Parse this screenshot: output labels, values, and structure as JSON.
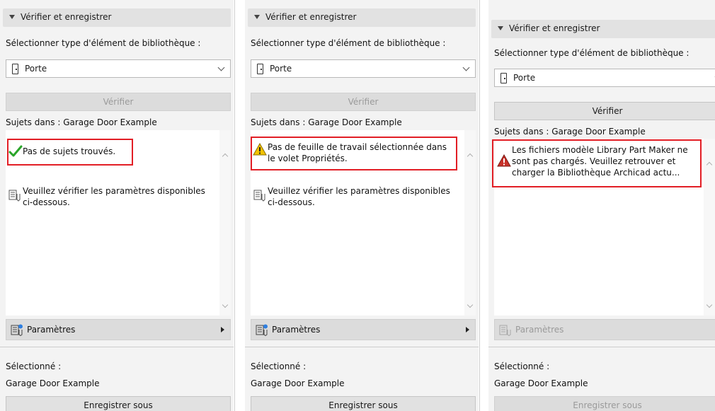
{
  "panels": [
    {
      "header": "Vérifier et enregistrer",
      "select_label": "Sélectionner type d'élément de bibliothèque :",
      "select_value": "Porte",
      "verify_label": "Vérifier",
      "subjects_label": "Sujets dans : Garage Door Example",
      "issue_icon": "check-icon",
      "issue_text_lines": [
        "Pas de sujets trouvés."
      ],
      "info_lines": [
        "Veuillez vérifier les paramètres disponibles",
        "ci-dessous."
      ],
      "params_label": "Paramètres",
      "selected_label": "Sélectionné :",
      "selected_value": "Garage Door Example",
      "save_label": "Enregistrer sous"
    },
    {
      "header": "Vérifier et enregistrer",
      "select_label": "Sélectionner type d'élément de bibliothèque :",
      "select_value": "Porte",
      "verify_label": "Vérifier",
      "subjects_label": "Sujets dans : Garage Door Example",
      "issue_icon": "warning-icon",
      "issue_text_lines": [
        "Pas de feuille de travail sélectionnée dans",
        "le volet Propriétés."
      ],
      "info_lines": [
        "Veuillez vérifier les paramètres disponibles",
        "ci-dessous."
      ],
      "params_label": "Paramètres",
      "selected_label": "Sélectionné :",
      "selected_value": "Garage Door Example",
      "save_label": "Enregistrer sous"
    },
    {
      "header": "Vérifier et enregistrer",
      "select_label": "Sélectionner type d'élément de bibliothèque :",
      "select_value": "Porte",
      "verify_label": "Vérifier",
      "subjects_label": "Sujets dans : Garage Door Example",
      "issue_icon": "error-icon",
      "issue_text_lines": [
        "Les fichiers modèle Library Part Maker ne",
        "sont pas chargés. Veuillez retrouver et",
        "charger la Bibliothèque Archicad actu..."
      ],
      "params_label": "Paramètres",
      "selected_label": "Sélectionné :",
      "selected_value": "Garage Door Example",
      "save_label": "Enregistrer sous"
    }
  ],
  "colors": {
    "highlight_box": "#e21e25",
    "check": "#2aa52a",
    "warning": "#f2c200",
    "error": "#c8312a",
    "param_badge": "#2f7fe0"
  }
}
